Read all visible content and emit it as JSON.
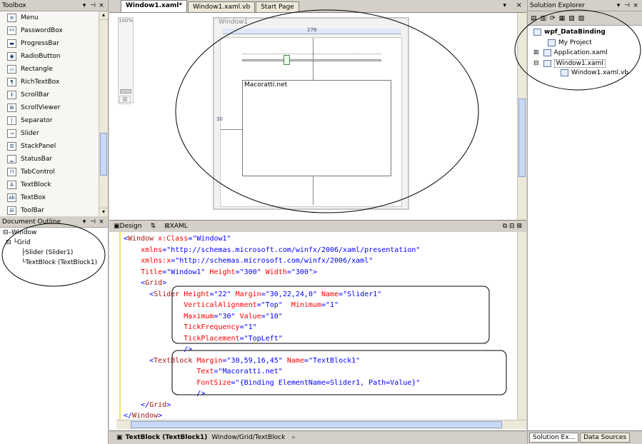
{
  "toolbox": {
    "title": "Toolbox",
    "items": [
      {
        "label": "Menu",
        "icon": "menu-icon",
        "glyph": "≡"
      },
      {
        "label": "PasswordBox",
        "icon": "passwordbox-icon",
        "glyph": "**"
      },
      {
        "label": "ProgressBar",
        "icon": "progressbar-icon",
        "glyph": "▬"
      },
      {
        "label": "RadioButton",
        "icon": "radiobutton-icon",
        "glyph": "◉"
      },
      {
        "label": "Rectangle",
        "icon": "rectangle-icon",
        "glyph": "▭"
      },
      {
        "label": "RichTextBox",
        "icon": "richtextbox-icon",
        "glyph": "¶"
      },
      {
        "label": "ScrollBar",
        "icon": "scrollbar-icon",
        "glyph": "↕"
      },
      {
        "label": "ScrollViewer",
        "icon": "scrollviewer-icon",
        "glyph": "⊞"
      },
      {
        "label": "Separator",
        "icon": "separator-icon",
        "glyph": "|"
      },
      {
        "label": "Slider",
        "icon": "slider-icon",
        "glyph": "⊸"
      },
      {
        "label": "StackPanel",
        "icon": "stackpanel-icon",
        "glyph": "☰"
      },
      {
        "label": "StatusBar",
        "icon": "statusbar-icon",
        "glyph": "▁"
      },
      {
        "label": "TabControl",
        "icon": "tabcontrol-icon",
        "glyph": "⊓"
      },
      {
        "label": "TextBlock",
        "icon": "textblock-icon",
        "glyph": "A"
      },
      {
        "label": "TextBox",
        "icon": "textbox-icon",
        "glyph": "ab"
      },
      {
        "label": "ToolBar",
        "icon": "toolbar-icon",
        "glyph": "⊟"
      }
    ]
  },
  "outline": {
    "title": "Document Outline",
    "nodes": [
      "Window",
      "Grid",
      "Slider (Slider1)",
      "TextBlock (TextBlock1)"
    ]
  },
  "designer": {
    "tabs": [
      "Window1.xaml*",
      "Window1.xaml.vb",
      "Start Page"
    ],
    "zoom": "100%",
    "window_title": "Window1",
    "ruler_value": "278",
    "textblock_text": "Macoratti.net",
    "margin_left_value": "30"
  },
  "split": {
    "design_tab": "Design",
    "swap_glyph": "⇅",
    "xaml_tab": "XAML"
  },
  "code_lines": [
    {
      "parts": [
        [
          "brk",
          "<"
        ],
        [
          "tag",
          "Window"
        ],
        [
          "attr",
          " x:Class"
        ],
        [
          "brk",
          "="
        ],
        [
          "val",
          "\"Window1\""
        ]
      ]
    },
    {
      "parts": [
        [
          "attr",
          "    xmlns"
        ],
        [
          "brk",
          "="
        ],
        [
          "val",
          "\"http://schemas.microsoft.com/winfx/2006/xaml/presentation\""
        ]
      ]
    },
    {
      "parts": [
        [
          "attr",
          "    xmlns:x"
        ],
        [
          "brk",
          "="
        ],
        [
          "val",
          "\"http://schemas.microsoft.com/winfx/2006/xaml\""
        ]
      ]
    },
    {
      "parts": [
        [
          "attr",
          "    Title"
        ],
        [
          "brk",
          "="
        ],
        [
          "val",
          "\"Window1\""
        ],
        [
          "attr",
          " Height"
        ],
        [
          "brk",
          "="
        ],
        [
          "val",
          "\"300\""
        ],
        [
          "attr",
          " Width"
        ],
        [
          "brk",
          "="
        ],
        [
          "val",
          "\"300\""
        ],
        [
          "brk",
          ">"
        ]
      ]
    },
    {
      "parts": [
        [
          "brk",
          "    <"
        ],
        [
          "tag",
          "Grid"
        ],
        [
          "brk",
          ">"
        ]
      ]
    },
    {
      "parts": [
        [
          "brk",
          "      <"
        ],
        [
          "tag",
          "Slider"
        ],
        [
          "attr",
          " Height"
        ],
        [
          "brk",
          "="
        ],
        [
          "val",
          "\"22\""
        ],
        [
          "attr",
          " Margin"
        ],
        [
          "brk",
          "="
        ],
        [
          "val",
          "\"30,22,24,0\""
        ],
        [
          "attr",
          " Name"
        ],
        [
          "brk",
          "="
        ],
        [
          "val",
          "\"Slider1\""
        ]
      ]
    },
    {
      "parts": [
        [
          "attr",
          "              VerticalAlignment"
        ],
        [
          "brk",
          "="
        ],
        [
          "val",
          "\"Top\""
        ],
        [
          "attr",
          "  Minimum"
        ],
        [
          "brk",
          "="
        ],
        [
          "val",
          "\"1\""
        ]
      ]
    },
    {
      "parts": [
        [
          "attr",
          "              Maximum"
        ],
        [
          "brk",
          "="
        ],
        [
          "val",
          "\"30\""
        ],
        [
          "attr",
          " Value"
        ],
        [
          "brk",
          "="
        ],
        [
          "val",
          "\"10\""
        ]
      ]
    },
    {
      "parts": [
        [
          "attr",
          "              TickFrequency"
        ],
        [
          "brk",
          "="
        ],
        [
          "val",
          "\"1\""
        ]
      ]
    },
    {
      "parts": [
        [
          "attr",
          "              TickPlacement"
        ],
        [
          "brk",
          "="
        ],
        [
          "val",
          "\"TopLeft\""
        ]
      ]
    },
    {
      "parts": [
        [
          "brk",
          "              />"
        ]
      ]
    },
    {
      "parts": [
        [
          "brk",
          "      <"
        ],
        [
          "tag",
          "TextBlock"
        ],
        [
          "attr",
          " Margin"
        ],
        [
          "brk",
          "="
        ],
        [
          "val",
          "\"30,59,16,45\""
        ],
        [
          "attr",
          " Name"
        ],
        [
          "brk",
          "="
        ],
        [
          "val",
          "\"TextBlock1\""
        ]
      ]
    },
    {
      "parts": [
        [
          "attr",
          "                 Text"
        ],
        [
          "brk",
          "="
        ],
        [
          "val",
          "\"Macoratti.net\""
        ]
      ]
    },
    {
      "parts": [
        [
          "attr",
          "                 FontSize"
        ],
        [
          "brk",
          "="
        ],
        [
          "val",
          "\"{Binding ElementName=Slider1, Path=Value}\""
        ]
      ]
    },
    {
      "parts": [
        [
          "brk",
          "                 />"
        ]
      ]
    },
    {
      "parts": [
        [
          "brk",
          "    </"
        ],
        [
          "tag",
          "Grid"
        ],
        [
          "brk",
          ">"
        ]
      ]
    },
    {
      "parts": [
        [
          "brk",
          "</"
        ],
        [
          "tag",
          "Window"
        ],
        [
          "brk",
          ">"
        ]
      ]
    }
  ],
  "statusbar": {
    "element": "TextBlock (TextBlock1)",
    "path": "Window/Grid/TextBlock"
  },
  "solution": {
    "title": "Solution Explorer",
    "project": "wpf_DataBinding",
    "items": [
      "My Project",
      "Application.xaml",
      "Window1.xaml",
      "Window1.xaml.vb"
    ],
    "bottom_tabs": [
      "Solution Ex...",
      "Data Sources"
    ]
  },
  "glyphs": {
    "pin": "ᵖ",
    "close": "×",
    "dropdown": "▾",
    "up": "▴",
    "down": "▾",
    "left": "◂",
    "right": "▸"
  }
}
